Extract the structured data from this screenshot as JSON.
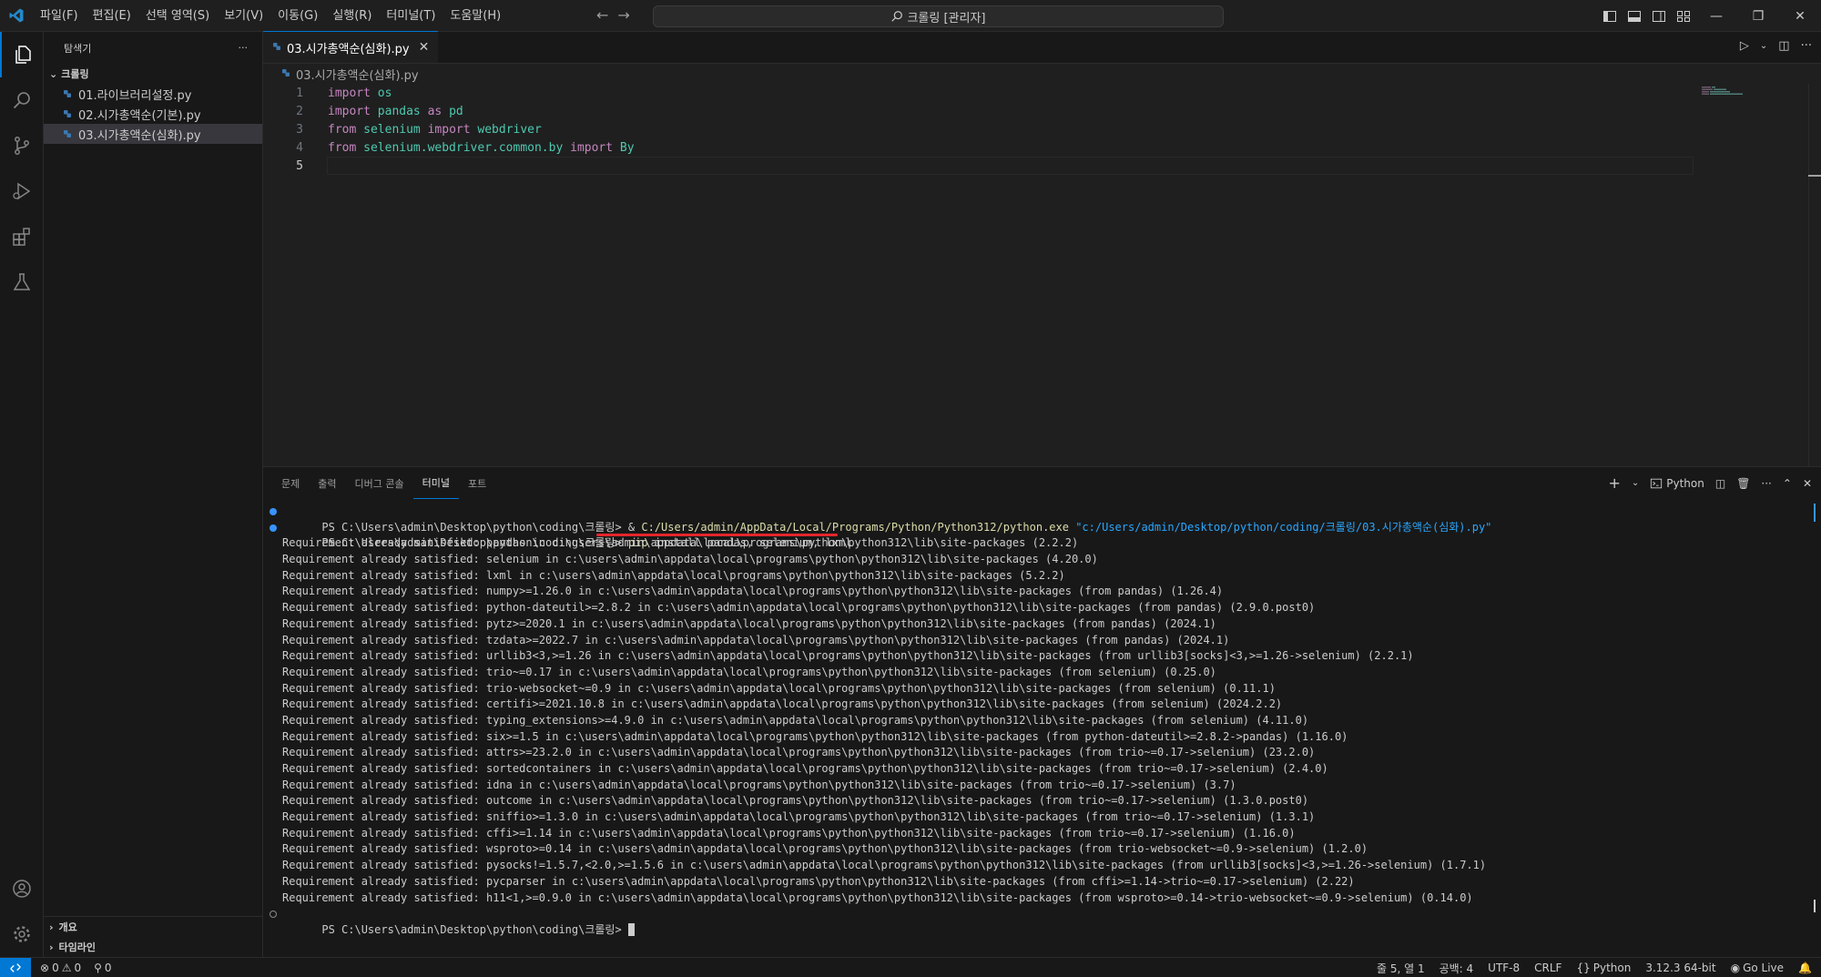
{
  "titlebar": {
    "menus": [
      "파일(F)",
      "편집(E)",
      "선택 영역(S)",
      "보기(V)",
      "이동(G)",
      "실행(R)",
      "터미널(T)",
      "도움말(H)"
    ],
    "search": "크롤링 [관리자]"
  },
  "sidebar": {
    "title": "탐색기",
    "more": "···",
    "folder": "크롤링",
    "files": [
      "01.라이브러리설정.py",
      "02.시가총액순(기본).py",
      "03.시가총액순(심화).py"
    ],
    "outline": "개요",
    "timeline": "타임라인"
  },
  "editor": {
    "tab_label": "03.시가총액순(심화).py",
    "breadcrumb": "03.시가총액순(심화).py",
    "line_numbers": [
      "1",
      "2",
      "3",
      "4",
      "5"
    ]
  },
  "code": {
    "l1": {
      "kw": "import",
      "mod": "os"
    },
    "l2": {
      "kw1": "import",
      "mod": "pandas",
      "kw2": "as",
      "alias": "pd"
    },
    "l3": {
      "kw1": "from",
      "mod": "selenium",
      "kw2": "import",
      "name": "webdriver"
    },
    "l4": {
      "kw1": "from",
      "mod": "selenium.webdriver.common.by",
      "kw2": "import",
      "name": "By"
    }
  },
  "panel": {
    "tabs": [
      "문제",
      "출력",
      "디버그 콘솔",
      "터미널",
      "포트"
    ],
    "active_tab": "터미널",
    "shell_label": "Python",
    "more": "···"
  },
  "terminal": {
    "line1_prompt": "PS C:\\Users\\admin\\Desktop\\python\\coding\\크롤링> & ",
    "line1_exe": "C:/Users/admin/AppData/Local/Programs/Python/Python312/python.exe",
    "line1_arg": " \"c:/Users/admin/Desktop/python/coding/크롤링/03.시가총액순(심화).py\"",
    "line2_prompt": "PS C:\\Users\\admin\\Desktop\\python\\coding\\크롤링> ",
    "line2_cmd": "pip",
    "line2_args": " install pandas, selenium, lxml",
    "output": [
      "Requirement already satisfied: pandas in c:\\users\\admin\\appdata\\local\\programs\\python\\python312\\lib\\site-packages (2.2.2)",
      "Requirement already satisfied: selenium in c:\\users\\admin\\appdata\\local\\programs\\python\\python312\\lib\\site-packages (4.20.0)",
      "Requirement already satisfied: lxml in c:\\users\\admin\\appdata\\local\\programs\\python\\python312\\lib\\site-packages (5.2.2)",
      "Requirement already satisfied: numpy>=1.26.0 in c:\\users\\admin\\appdata\\local\\programs\\python\\python312\\lib\\site-packages (from pandas) (1.26.4)",
      "Requirement already satisfied: python-dateutil>=2.8.2 in c:\\users\\admin\\appdata\\local\\programs\\python\\python312\\lib\\site-packages (from pandas) (2.9.0.post0)",
      "Requirement already satisfied: pytz>=2020.1 in c:\\users\\admin\\appdata\\local\\programs\\python\\python312\\lib\\site-packages (from pandas) (2024.1)",
      "Requirement already satisfied: tzdata>=2022.7 in c:\\users\\admin\\appdata\\local\\programs\\python\\python312\\lib\\site-packages (from pandas) (2024.1)",
      "Requirement already satisfied: urllib3<3,>=1.26 in c:\\users\\admin\\appdata\\local\\programs\\python\\python312\\lib\\site-packages (from urllib3[socks]<3,>=1.26->selenium) (2.2.1)",
      "Requirement already satisfied: trio~=0.17 in c:\\users\\admin\\appdata\\local\\programs\\python\\python312\\lib\\site-packages (from selenium) (0.25.0)",
      "Requirement already satisfied: trio-websocket~=0.9 in c:\\users\\admin\\appdata\\local\\programs\\python\\python312\\lib\\site-packages (from selenium) (0.11.1)",
      "Requirement already satisfied: certifi>=2021.10.8 in c:\\users\\admin\\appdata\\local\\programs\\python\\python312\\lib\\site-packages (from selenium) (2024.2.2)",
      "Requirement already satisfied: typing_extensions>=4.9.0 in c:\\users\\admin\\appdata\\local\\programs\\python\\python312\\lib\\site-packages (from selenium) (4.11.0)",
      "Requirement already satisfied: six>=1.5 in c:\\users\\admin\\appdata\\local\\programs\\python\\python312\\lib\\site-packages (from python-dateutil>=2.8.2->pandas) (1.16.0)",
      "Requirement already satisfied: attrs>=23.2.0 in c:\\users\\admin\\appdata\\local\\programs\\python\\python312\\lib\\site-packages (from trio~=0.17->selenium) (23.2.0)",
      "Requirement already satisfied: sortedcontainers in c:\\users\\admin\\appdata\\local\\programs\\python\\python312\\lib\\site-packages (from trio~=0.17->selenium) (2.4.0)",
      "Requirement already satisfied: idna in c:\\users\\admin\\appdata\\local\\programs\\python\\python312\\lib\\site-packages (from trio~=0.17->selenium) (3.7)",
      "Requirement already satisfied: outcome in c:\\users\\admin\\appdata\\local\\programs\\python\\python312\\lib\\site-packages (from trio~=0.17->selenium) (1.3.0.post0)",
      "Requirement already satisfied: sniffio>=1.3.0 in c:\\users\\admin\\appdata\\local\\programs\\python\\python312\\lib\\site-packages (from trio~=0.17->selenium) (1.3.1)",
      "Requirement already satisfied: cffi>=1.14 in c:\\users\\admin\\appdata\\local\\programs\\python\\python312\\lib\\site-packages (from trio~=0.17->selenium) (1.16.0)",
      "Requirement already satisfied: wsproto>=0.14 in c:\\users\\admin\\appdata\\local\\programs\\python\\python312\\lib\\site-packages (from trio-websocket~=0.9->selenium) (1.2.0)",
      "Requirement already satisfied: pysocks!=1.5.7,<2.0,>=1.5.6 in c:\\users\\admin\\appdata\\local\\programs\\python\\python312\\lib\\site-packages (from urllib3[socks]<3,>=1.26->selenium) (1.7.1)",
      "Requirement already satisfied: pycparser in c:\\users\\admin\\appdata\\local\\programs\\python\\python312\\lib\\site-packages (from cffi>=1.14->trio~=0.17->selenium) (2.22)",
      "Requirement already satisfied: h11<1,>=0.9.0 in c:\\users\\admin\\appdata\\local\\programs\\python\\python312\\lib\\site-packages (from wsproto>=0.14->trio-websocket~=0.9->selenium) (0.14.0)"
    ],
    "last_prompt": "PS C:\\Users\\admin\\Desktop\\python\\coding\\크롤링> "
  },
  "statusbar": {
    "errors": "0",
    "warnings": "0",
    "ports": "0",
    "position": "줄 5, 열 1",
    "spaces": "공백: 4",
    "encoding": "UTF-8",
    "eol": "CRLF",
    "language": "Python",
    "interpreter": "3.12.3 64-bit",
    "golive": "Go Live"
  },
  "colors": {
    "accent": "#0078d4",
    "highlight": "#e5262b"
  }
}
